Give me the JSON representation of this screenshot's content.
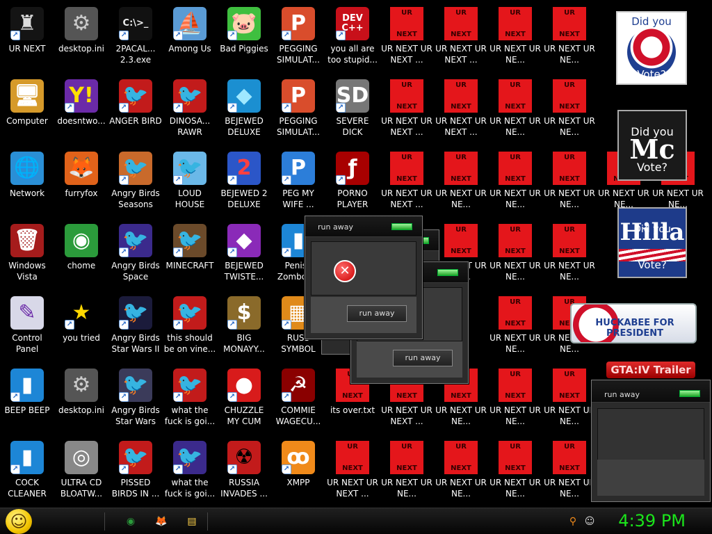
{
  "desktop": {
    "icons": [
      {
        "col": 0,
        "row": 0,
        "label": "UR NEXT",
        "glyph": "♜",
        "bg": "#141414",
        "fg": "#ddd",
        "sc": true
      },
      {
        "col": 1,
        "row": 0,
        "label": "desktop.ini",
        "glyph": "⚙",
        "bg": "#555",
        "fg": "#ccc",
        "sc": false
      },
      {
        "col": 2,
        "row": 0,
        "label": "2PACAL... 2.3.exe",
        "glyph": "C:\\>_",
        "bg": "#111",
        "fg": "#eee",
        "sc": true,
        "small": true
      },
      {
        "col": 3,
        "row": 0,
        "label": "Among Us",
        "glyph": "⛵",
        "bg": "#5a9bd5",
        "fg": "#ffe270",
        "sc": true
      },
      {
        "col": 4,
        "row": 0,
        "label": "Bad Piggies",
        "glyph": "🐷",
        "bg": "#3fbf3f",
        "fg": "#145a14",
        "sc": true
      },
      {
        "col": 5,
        "row": 0,
        "label": "PEGGING SIMULAT...",
        "glyph": "P",
        "bg": "#d94d2c",
        "fg": "#fff",
        "sc": true
      },
      {
        "col": 6,
        "row": 0,
        "label": "you all are too stupid...",
        "glyph": "DEV C++",
        "bg": "#c8101a",
        "fg": "#fff",
        "sc": true,
        "small": true
      },
      {
        "col": 0,
        "row": 1,
        "label": "Computer",
        "glyph": "🖥",
        "bg": "#d69a2a",
        "fg": "#fff",
        "sc": false
      },
      {
        "col": 1,
        "row": 1,
        "label": "doesntwo...",
        "glyph": "Y!",
        "bg": "#6b2aa8",
        "fg": "#ffe000",
        "sc": true
      },
      {
        "col": 2,
        "row": 1,
        "label": "ANGER BIRD",
        "glyph": "🐦",
        "bg": "#c21b1b",
        "fg": "#fff",
        "sc": true
      },
      {
        "col": 3,
        "row": 1,
        "label": "DINOSA... RAWR",
        "glyph": "🐦",
        "bg": "#c21b1b",
        "fg": "#fff",
        "sc": true
      },
      {
        "col": 4,
        "row": 1,
        "label": "BEJEWED DELUXE",
        "glyph": "◆",
        "bg": "#1b8fd1",
        "fg": "#9fe8ff",
        "sc": true
      },
      {
        "col": 5,
        "row": 1,
        "label": "PEGGING SIMULAT...",
        "glyph": "P",
        "bg": "#d94d2c",
        "fg": "#fff",
        "sc": true
      },
      {
        "col": 6,
        "row": 1,
        "label": "SEVERE DICK",
        "glyph": "SD",
        "bg": "#777",
        "fg": "#fff",
        "sc": true
      },
      {
        "col": 0,
        "row": 2,
        "label": "Network",
        "glyph": "🌐",
        "bg": "#2a8fd6",
        "fg": "#fff",
        "sc": false
      },
      {
        "col": 1,
        "row": 2,
        "label": "furryfox",
        "glyph": "🦊",
        "bg": "#e0621a",
        "fg": "#fff",
        "sc": false
      },
      {
        "col": 2,
        "row": 2,
        "label": "Angry Birds Seasons",
        "glyph": "🐦",
        "bg": "#c96a2b",
        "fg": "#fff",
        "sc": true
      },
      {
        "col": 3,
        "row": 2,
        "label": "LOUD HOUSE",
        "glyph": "🐦",
        "bg": "#6bb8e8",
        "fg": "#d8408c",
        "sc": true
      },
      {
        "col": 4,
        "row": 2,
        "label": "BEJEWED 2 DELUXE",
        "glyph": "2",
        "bg": "#2b56c8",
        "fg": "#ff4040",
        "sc": true
      },
      {
        "col": 5,
        "row": 2,
        "label": "PEG MY WIFE ...",
        "glyph": "P",
        "bg": "#2c7ed9",
        "fg": "#fff",
        "sc": true
      },
      {
        "col": 6,
        "row": 2,
        "label": "PORNO PLAYER",
        "glyph": "ƒ",
        "bg": "#a80000",
        "fg": "#fff",
        "sc": true
      },
      {
        "col": 0,
        "row": 3,
        "label": "Windows Vista",
        "glyph": "🗑",
        "bg": "#a51c1c",
        "fg": "#fff",
        "sc": false
      },
      {
        "col": 1,
        "row": 3,
        "label": "chome",
        "glyph": "◉",
        "bg": "#2b9b3b",
        "fg": "#fff",
        "sc": false
      },
      {
        "col": 2,
        "row": 3,
        "label": "Angry Birds Space",
        "glyph": "🐦",
        "bg": "#3b2a8c",
        "fg": "#fff",
        "sc": true
      },
      {
        "col": 3,
        "row": 3,
        "label": "MINECRAFT",
        "glyph": "🐦",
        "bg": "#6b4a2a",
        "fg": "#fff",
        "sc": true
      },
      {
        "col": 4,
        "row": 3,
        "label": "BEJEWED TWISTE...",
        "glyph": "◆",
        "bg": "#8a2ab8",
        "fg": "#fff",
        "sc": true
      },
      {
        "col": 5,
        "row": 3,
        "label": "Penise Zomboc...",
        "glyph": "▮",
        "bg": "#1d86d6",
        "fg": "#fff",
        "sc": true
      },
      {
        "col": 0,
        "row": 4,
        "label": "Control Panel",
        "glyph": "✎",
        "bg": "#d8d8e8",
        "fg": "#6b2aa8",
        "sc": false
      },
      {
        "col": 1,
        "row": 4,
        "label": "you tried",
        "glyph": "★",
        "bg": "#000",
        "fg": "#ffd800",
        "sc": true
      },
      {
        "col": 2,
        "row": 4,
        "label": "Angry Birds Star Wars II",
        "glyph": "🐦",
        "bg": "#1b1b3b",
        "fg": "#ffd800",
        "sc": true
      },
      {
        "col": 3,
        "row": 4,
        "label": "this should be on vine...",
        "glyph": "🐦",
        "bg": "#c21b1b",
        "fg": "#fff",
        "sc": true
      },
      {
        "col": 4,
        "row": 4,
        "label": "BIG MONAYY...",
        "glyph": "$",
        "bg": "#8a6a2a",
        "fg": "#fff",
        "sc": true
      },
      {
        "col": 5,
        "row": 4,
        "label": "RUSS SYMBOL",
        "glyph": "▦",
        "bg": "#e08a1a",
        "fg": "#fff",
        "sc": true
      },
      {
        "col": 0,
        "row": 5,
        "label": "BEEP BEEP",
        "glyph": "▮",
        "bg": "#1d86d6",
        "fg": "#fff",
        "sc": true
      },
      {
        "col": 1,
        "row": 5,
        "label": "desktop.ini",
        "glyph": "⚙",
        "bg": "#555",
        "fg": "#ccc",
        "sc": false
      },
      {
        "col": 2,
        "row": 5,
        "label": "Angry Birds Star Wars",
        "glyph": "🐦",
        "bg": "#3b3b5a",
        "fg": "#fff",
        "sc": true
      },
      {
        "col": 3,
        "row": 5,
        "label": "what the fuck is goi...",
        "glyph": "🐦",
        "bg": "#c21b1b",
        "fg": "#fff",
        "sc": true
      },
      {
        "col": 4,
        "row": 5,
        "label": "CHUZZLE MY CUM",
        "glyph": "●",
        "bg": "#d81b1b",
        "fg": "#fff",
        "sc": true
      },
      {
        "col": 5,
        "row": 5,
        "label": "COMMIE WAGECU...",
        "glyph": "☭",
        "bg": "#8a0000",
        "fg": "#fff",
        "sc": true
      },
      {
        "col": 6,
        "row": 5,
        "label": "its over.txt",
        "glyph": "",
        "bg": "#e4161b",
        "fg": "#fff",
        "sc": false,
        "urn": true
      },
      {
        "col": 0,
        "row": 6,
        "label": "COCK CLEANER",
        "glyph": "▮",
        "bg": "#1d86d6",
        "fg": "#fff",
        "sc": true
      },
      {
        "col": 1,
        "row": 6,
        "label": "ULTRA CD BLOATW...",
        "glyph": "◎",
        "bg": "#888",
        "fg": "#fff",
        "sc": false
      },
      {
        "col": 2,
        "row": 6,
        "label": "PISSED BIRDS IN ...",
        "glyph": "🐦",
        "bg": "#c21b1b",
        "fg": "#fff",
        "sc": true
      },
      {
        "col": 3,
        "row": 6,
        "label": "what the fuck is goi...",
        "glyph": "🐦",
        "bg": "#3b2a8c",
        "fg": "#fff",
        "sc": true
      },
      {
        "col": 4,
        "row": 6,
        "label": "RUSSIA INVADES ...",
        "glyph": "☢",
        "bg": "#c21b1b",
        "fg": "#000",
        "sc": true
      },
      {
        "col": 5,
        "row": 6,
        "label": "XMPP",
        "glyph": "ꝏ",
        "bg": "#f08a1a",
        "fg": "#fff",
        "sc": true
      },
      {
        "col": 6,
        "row": 6,
        "label": "UR NEXT UR NEXT ...",
        "glyph": "",
        "urn": true
      },
      {
        "col": 7,
        "row": 0,
        "label": "UR NEXT UR NEXT ...",
        "urn": true
      },
      {
        "col": 8,
        "row": 0,
        "label": "UR NEXT UR NEXT ...",
        "urn": true
      },
      {
        "col": 9,
        "row": 0,
        "label": "UR NEXT UR NE...",
        "urn": true
      },
      {
        "col": 10,
        "row": 0,
        "label": "UR NEXT UR NE...",
        "urn": true
      },
      {
        "col": 7,
        "row": 1,
        "label": "UR NEXT UR NEXT ...",
        "urn": true
      },
      {
        "col": 8,
        "row": 1,
        "label": "UR NEXT UR NEXT ...",
        "urn": true
      },
      {
        "col": 9,
        "row": 1,
        "label": "UR NEXT UR NE...",
        "urn": true
      },
      {
        "col": 10,
        "row": 1,
        "label": "UR NEXT UR NE...",
        "urn": true
      },
      {
        "col": 7,
        "row": 2,
        "label": "UR NEXT UR NEXT ...",
        "urn": true
      },
      {
        "col": 8,
        "row": 2,
        "label": "UR NEXT UR NE...",
        "urn": true
      },
      {
        "col": 9,
        "row": 2,
        "label": "UR NEXT UR NE...",
        "urn": true
      },
      {
        "col": 10,
        "row": 2,
        "label": "UR NEXT UR NE...",
        "urn": true
      },
      {
        "col": 11,
        "row": 2,
        "label": "UR NEXT UR NE...",
        "urn": true
      },
      {
        "col": 12,
        "row": 2,
        "label": "UR NEXT UR NE...",
        "urn": true
      },
      {
        "col": 8,
        "row": 3,
        "label": "UR NEXT UR NE...",
        "urn": true
      },
      {
        "col": 9,
        "row": 3,
        "label": "UR NEXT UR NE...",
        "urn": true
      },
      {
        "col": 10,
        "row": 3,
        "label": "UR NEXT UR NE...",
        "urn": true
      },
      {
        "col": 9,
        "row": 4,
        "label": "UR NEXT UR NE...",
        "urn": true
      },
      {
        "col": 10,
        "row": 4,
        "label": "UR NEXT UR NE...",
        "urn": true
      },
      {
        "col": 7,
        "row": 5,
        "label": "UR NEXT UR NEXT ...",
        "urn": true
      },
      {
        "col": 8,
        "row": 5,
        "label": "UR NEXT UR NE...",
        "urn": true
      },
      {
        "col": 9,
        "row": 5,
        "label": "UR NEXT UR NE...",
        "urn": true
      },
      {
        "col": 10,
        "row": 5,
        "label": "UR NEXT UR NE...",
        "urn": true
      },
      {
        "col": 7,
        "row": 6,
        "label": "UR NEXT UR NE...",
        "urn": true
      },
      {
        "col": 8,
        "row": 6,
        "label": "UR NEXT UR NE...",
        "urn": true
      },
      {
        "col": 9,
        "row": 6,
        "label": "UR NEXT UR NE...",
        "urn": true
      },
      {
        "col": 10,
        "row": 6,
        "label": "UR NEXT UR NE...",
        "urn": true
      }
    ],
    "urn_top": "UR",
    "urn_bottom": "NEXT"
  },
  "campaign": {
    "obama": {
      "top": "Did you",
      "bottom": "Vote?"
    },
    "mccain": {
      "top": "Did you",
      "mid": "Mc",
      "bottom": "Vote?"
    },
    "hillary": {
      "top": "Did you",
      "mid": "Hilla",
      "bottom": "Vote?"
    },
    "huckabee": "HUCKABEE FOR PRESIDENT",
    "gta": "GTA:IV Trailer"
  },
  "dialogs": {
    "title": "run away",
    "button": "run away",
    "error_glyph": "✕"
  },
  "taskbar": {
    "start_glyph": "☺",
    "pinned": [
      {
        "glyph": "◉",
        "color": "#2b9b3b"
      },
      {
        "glyph": "🦊",
        "color": "#e0621a"
      },
      {
        "glyph": "▤",
        "color": "#ffd24a"
      }
    ],
    "tray": [
      {
        "glyph": "⚲",
        "color": "#f08a1a"
      },
      {
        "glyph": "☺",
        "color": "#ddd"
      }
    ],
    "clock": "4:39 PM"
  }
}
